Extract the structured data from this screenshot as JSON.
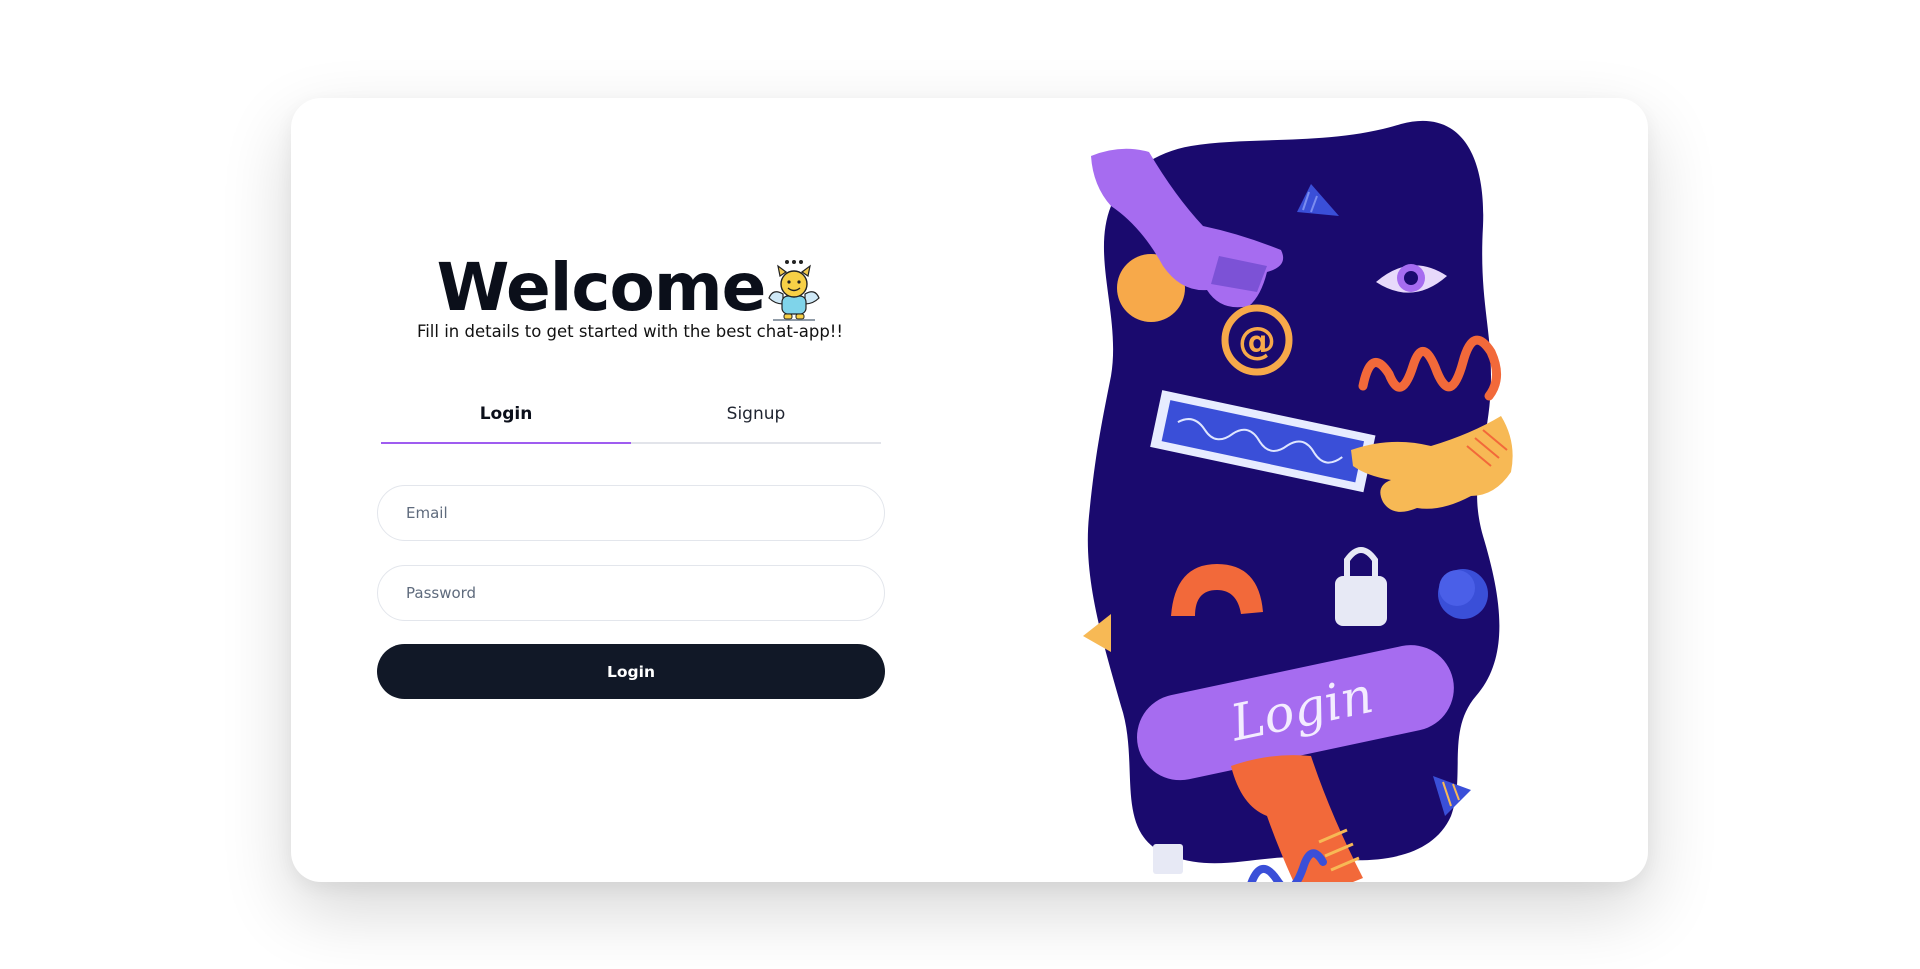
{
  "header": {
    "title": "Welcome",
    "subtitle": "Fill in details to get started with the best chat-app!!",
    "emoji_icon": "smiling-devil-angel-emoji"
  },
  "tabs": [
    {
      "label": "Login",
      "active": true
    },
    {
      "label": "Signup",
      "active": false
    }
  ],
  "form": {
    "email_placeholder": "Email",
    "email_value": "",
    "password_placeholder": "Password",
    "password_value": "",
    "submit_label": "Login"
  },
  "illustration": {
    "button_text": "Login",
    "icons": [
      "at-sign-icon",
      "eye-icon",
      "padlock-icon"
    ]
  },
  "colors": {
    "accent": "#9f5cf0",
    "button_bg": "#111827",
    "illustration_bg": "#1a0a6e",
    "purple": "#a66cf0",
    "orange": "#f2693a",
    "yellow": "#f7b955",
    "blue": "#3a4fd8"
  }
}
